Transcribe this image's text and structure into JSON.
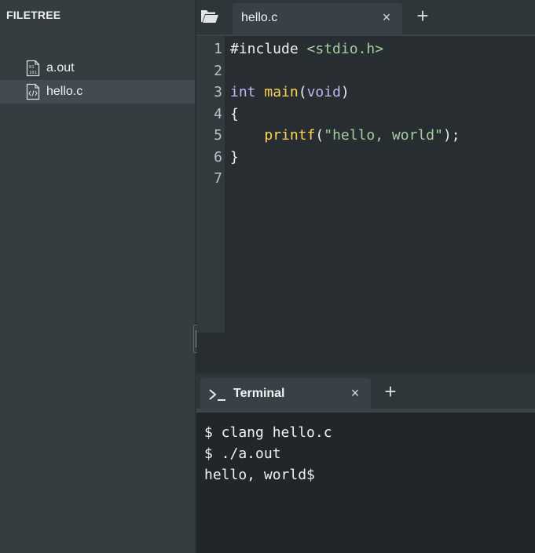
{
  "sidebar": {
    "title": "FILETREE",
    "files": [
      {
        "name": "a.out",
        "icon": "binary-file-icon",
        "selected": false
      },
      {
        "name": "hello.c",
        "icon": "code-file-icon",
        "selected": true
      }
    ]
  },
  "editor": {
    "tab": {
      "label": "hello.c",
      "close": "×"
    },
    "add_tab": "+",
    "line_numbers": [
      "1",
      "2",
      "3",
      "4",
      "5",
      "6",
      "7"
    ],
    "code": {
      "l1_directive": "#include",
      "l1_header": "<stdio.h>",
      "l3_type": "int",
      "l3_func": "main",
      "l3_open": "(",
      "l3_param": "void",
      "l3_close": ")",
      "l4": "{",
      "l5_indent": "    ",
      "l5_func": "printf",
      "l5_open": "(",
      "l5_string": "\"hello, world\"",
      "l5_close": ");",
      "l6": "}"
    }
  },
  "terminal": {
    "tab": {
      "label": "Terminal",
      "close": "×"
    },
    "add_tab": "+",
    "lines": [
      "$ clang hello.c",
      "$ ./a.out",
      "hello, world$"
    ]
  },
  "colors": {
    "sidebar_bg": "#363d41",
    "selected_bg": "#434b50",
    "keyword": "#c7b4f0",
    "function": "#ffd457",
    "string": "#a5cfa1"
  }
}
